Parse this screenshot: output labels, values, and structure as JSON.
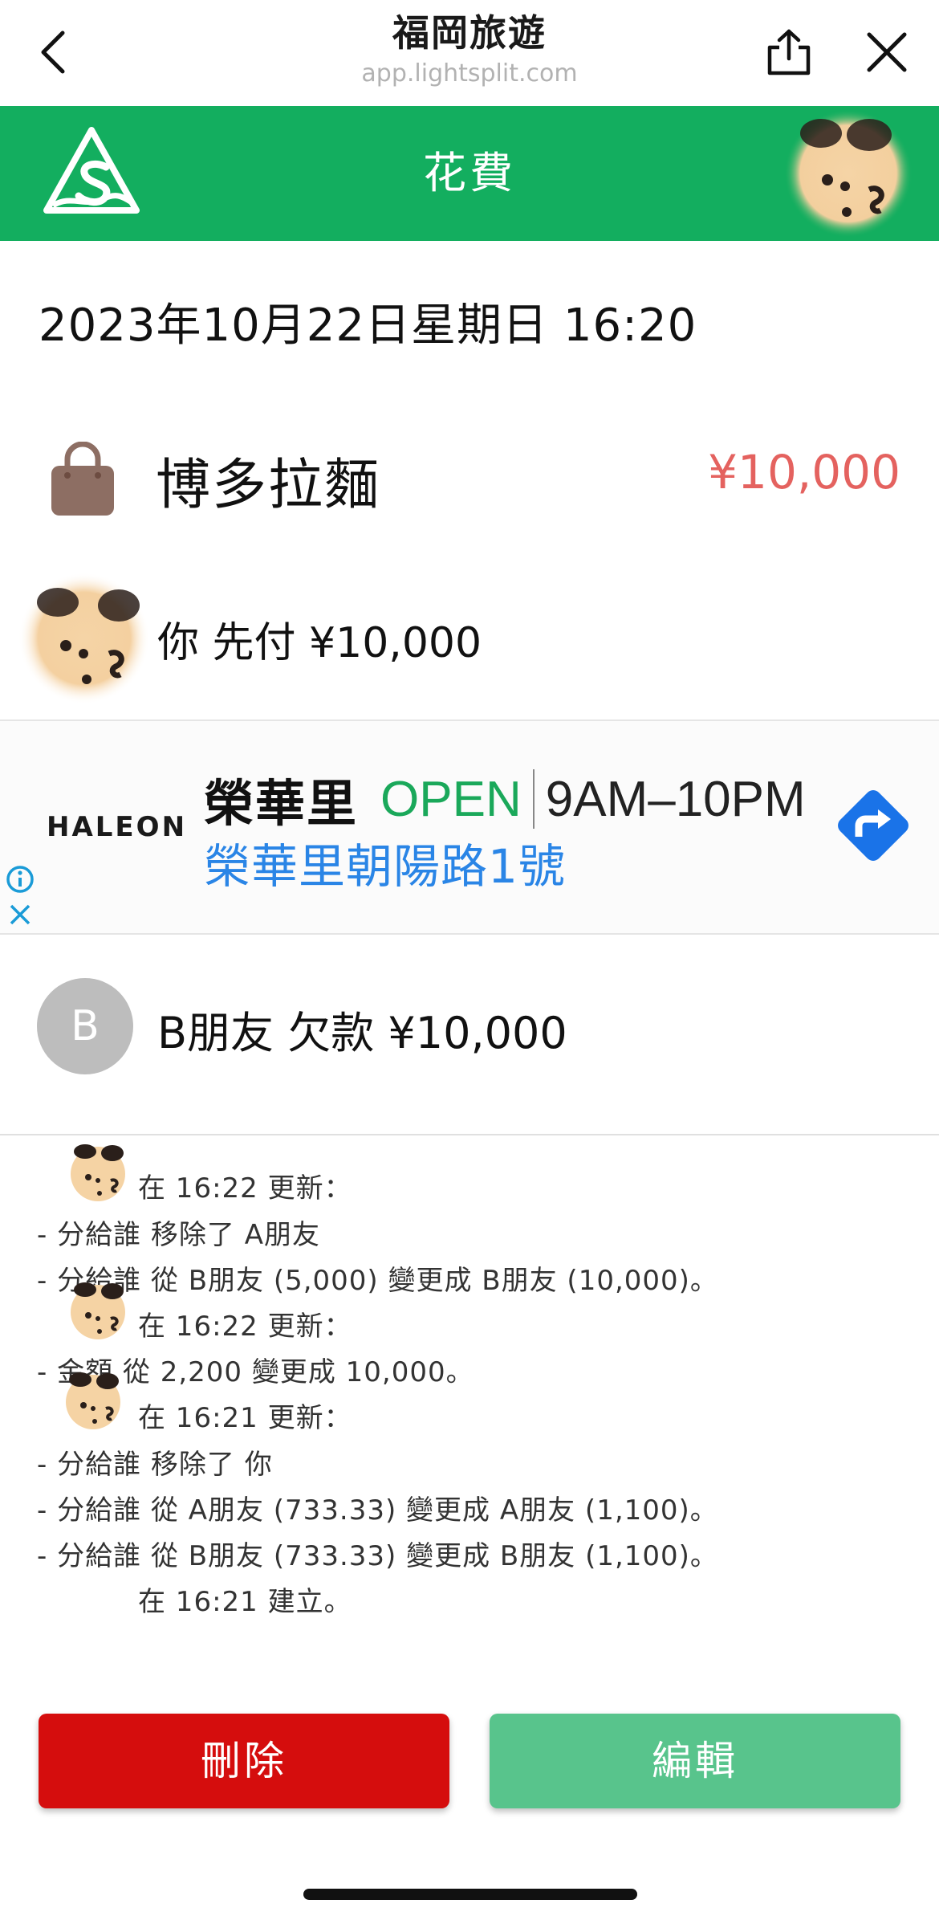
{
  "browser": {
    "title": "福岡旅遊",
    "url": "app.lightsplit.com",
    "icons": {
      "back": "chevron-left-icon",
      "share": "share-icon",
      "close": "close-icon"
    }
  },
  "header": {
    "title": "花費",
    "background_color": "#13ae5f",
    "logo": "lightsplit-logo"
  },
  "expense": {
    "datetime": "2023年10月22日星期日 16:20",
    "name": "博多拉麵",
    "amount": "¥10,000",
    "amount_color": "#e4625f",
    "category_icon": "shopping-bag-icon"
  },
  "payer": {
    "text": "你 先付 ¥10,000"
  },
  "ad": {
    "brand": "HALEON",
    "store": "榮華里",
    "open_label": "OPEN",
    "hours": "9AM–10PM",
    "address": "榮華里朝陽路1號",
    "icons": {
      "direction": "directions-icon",
      "info": "info-icon",
      "close": "close-icon"
    }
  },
  "debtor": {
    "initial": "B",
    "text": "B朋友 欠款 ¥10,000"
  },
  "history": {
    "entries": [
      {
        "head": "在 16:22 更新：",
        "lines": [
          "- 分給誰 移除了 A朋友",
          "- 分給誰 從 B朋友 (5,000) 變更成 B朋友 (10,000)。"
        ]
      },
      {
        "head": "在 16:22 更新：",
        "lines": [
          "- 金額 從 2,200 變更成 10,000。"
        ]
      },
      {
        "head": "在 16:21 更新：",
        "lines": [
          "- 分給誰 移除了 你",
          "- 分給誰 從 A朋友 (733.33) 變更成 A朋友 (1,100)。",
          "- 分給誰 從 B朋友 (733.33) 變更成 B朋友 (1,100)。"
        ]
      },
      {
        "head": "在 16:21 建立。",
        "lines": []
      }
    ]
  },
  "actions": {
    "delete_label": "刪除",
    "edit_label": "編輯",
    "delete_color": "#d50d0d",
    "edit_color": "#58c48c"
  }
}
